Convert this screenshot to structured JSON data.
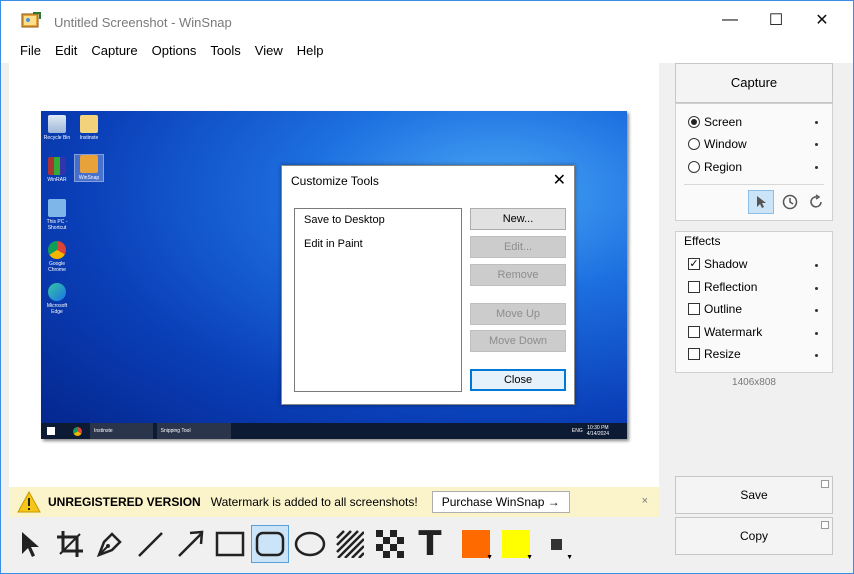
{
  "window": {
    "title": "Untitled Screenshot - WinSnap",
    "minimize_glyph": "—",
    "maximize_glyph": "☐",
    "close_glyph": "✕"
  },
  "menu": [
    "File",
    "Edit",
    "Capture",
    "Options",
    "Tools",
    "View",
    "Help"
  ],
  "screenshot": {
    "desktop_icons": [
      "Recycle Bin",
      "Instinste",
      "WinRAR",
      "WinSnap",
      "This PC - Shortcut",
      "Google Chrome",
      "Microsoft Edge"
    ],
    "taskbar": {
      "items": [
        "Instinste",
        "Snipping Tool"
      ],
      "lang": "ENG",
      "time": "10:30 PM",
      "date": "4/14/2024"
    },
    "dialog": {
      "title": "Customize Tools",
      "close_glyph": "✕",
      "list": [
        "Save to Desktop",
        "Edit in Paint"
      ],
      "buttons": {
        "new": "New...",
        "edit": "Edit...",
        "remove": "Remove",
        "move_up": "Move Up",
        "move_down": "Move Down",
        "close": "Close"
      }
    }
  },
  "panel": {
    "capture_label": "Capture",
    "modes": [
      {
        "label": "Screen",
        "selected": true
      },
      {
        "label": "Window",
        "selected": false
      },
      {
        "label": "Region",
        "selected": false
      }
    ],
    "effects_title": "Effects",
    "effects": [
      {
        "label": "Shadow",
        "checked": true
      },
      {
        "label": "Reflection",
        "checked": false
      },
      {
        "label": "Outline",
        "checked": false
      },
      {
        "label": "Watermark",
        "checked": false
      },
      {
        "label": "Resize",
        "checked": false
      }
    ],
    "dimensions": "1406x808",
    "save_label": "Save",
    "copy_label": "Copy"
  },
  "banner": {
    "title": "UNREGISTERED VERSION",
    "message": "Watermark is added to all screenshots!",
    "button": "Purchase WinSnap →",
    "close_glyph": "×"
  },
  "toolbar": {
    "tools": [
      "select-arrow",
      "crop",
      "pen",
      "line",
      "arrow",
      "rectangle",
      "rounded-rectangle",
      "ellipse",
      "hatch",
      "pixelate",
      "text"
    ],
    "selected_tool": "rounded-rectangle",
    "text_glyph": "T",
    "primary_color": "#ff6a00",
    "secondary_color": "#ffff00",
    "line_color": "#333333"
  }
}
